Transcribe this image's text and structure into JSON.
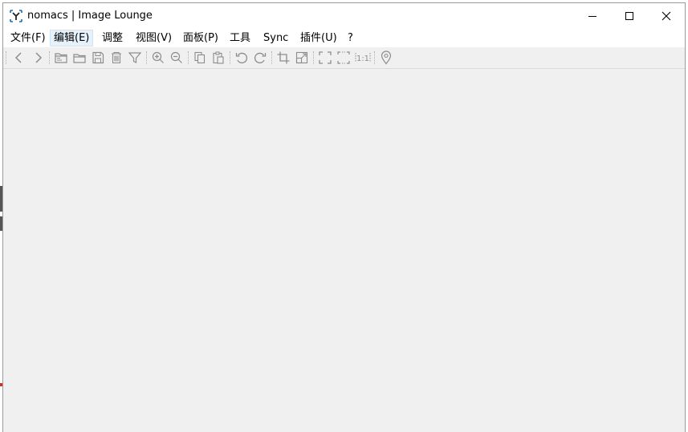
{
  "window": {
    "title": "nomacs | Image Lounge",
    "app_icon": "nomacs-icon",
    "controls": {
      "minimize": "minimize-icon",
      "maximize": "maximize-icon",
      "close": "close-icon"
    }
  },
  "menu": [
    {
      "label": "文件(F)",
      "active": false
    },
    {
      "label": "编辑(E)",
      "active": true
    },
    {
      "label": "调整",
      "active": false
    },
    {
      "label": "视图(V)",
      "active": false
    },
    {
      "label": "面板(P)",
      "active": false
    },
    {
      "label": "工具",
      "active": false
    },
    {
      "label": "Sync",
      "active": false
    },
    {
      "label": "插件(U)",
      "active": false
    },
    {
      "label": "?",
      "active": false
    }
  ],
  "toolbar": {
    "icons": [
      "previous-icon",
      "next-icon",
      "open-browser-icon",
      "open-folder-icon",
      "save-icon",
      "delete-icon",
      "filter-icon",
      "zoom-in-icon",
      "zoom-out-icon",
      "copy-icon",
      "paste-icon",
      "rotate-left-icon",
      "rotate-right-icon",
      "crop-icon",
      "resize-icon",
      "fullscreen-icon",
      "frameless-icon",
      "actual-size-icon",
      "location-icon"
    ],
    "actual_size_label": "1:1"
  },
  "colors": {
    "window_bg": "#f0f0f0",
    "titlebar_bg": "#ffffff",
    "menu_active_bg": "#e5f1fb",
    "icon_stroke": "#8c8c8c"
  }
}
